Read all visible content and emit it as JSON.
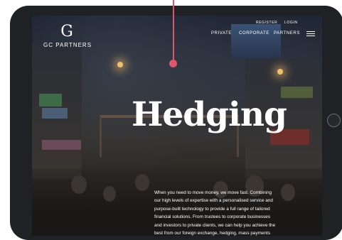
{
  "brand": {
    "name": "GC PARTNERS",
    "monogram": "G"
  },
  "nav": {
    "top": [
      "REGISTER",
      "LOGIN"
    ],
    "main": [
      "PRIVATE",
      "CORPORATE",
      "PARTNERS"
    ]
  },
  "hero": {
    "title": "Hedging"
  },
  "body": {
    "lines": [
      "When you need to move money, we move fast. Combining",
      "our high levels of expertise with a personalised service and",
      "purpose-built technology to provide a full range of tailored",
      "financial solutions. From trustees to corporate businesses",
      "and investors to private clients, we can help you achieve the",
      "best from our foreign exchange, hedging, mass payments"
    ]
  },
  "colors": {
    "accent": "#e0556b",
    "device": "#1f2124"
  },
  "icons": {
    "menu": "hamburger-icon",
    "pin": "location-pin-icon"
  }
}
